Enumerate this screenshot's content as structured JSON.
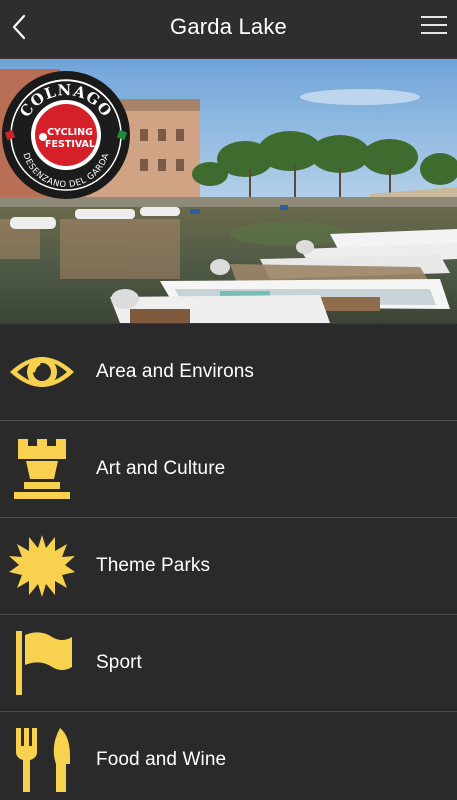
{
  "header": {
    "title": "Garda Lake",
    "back_icon": "chevron-left-icon",
    "menu_icon": "hamburger-menu-icon"
  },
  "hero": {
    "badge_top": "COLNAGO",
    "badge_center_line1": "CYCLING",
    "badge_center_line2": "FESTIVAL",
    "badge_bottom": "DESENZANO DEL GARDA"
  },
  "menu": {
    "accent_color": "#f8d24e",
    "items": [
      {
        "label": "Area and Environs",
        "icon": "eye-icon"
      },
      {
        "label": "Art and Culture",
        "icon": "chess-rook-icon"
      },
      {
        "label": "Theme Parks",
        "icon": "sun-burst-icon"
      },
      {
        "label": "Sport",
        "icon": "flag-icon"
      },
      {
        "label": "Food and Wine",
        "icon": "fork-knife-icon"
      }
    ]
  }
}
